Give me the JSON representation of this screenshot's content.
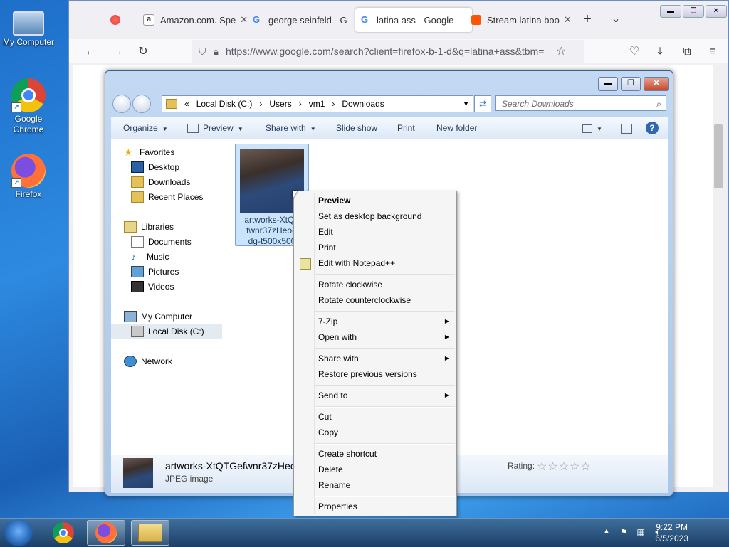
{
  "desktop": {
    "icons": [
      {
        "label": "My Computer"
      },
      {
        "label": "Google Chrome"
      },
      {
        "label": "Firefox"
      }
    ]
  },
  "firefox": {
    "tabs": [
      {
        "label": ""
      },
      {
        "label": "Amazon.com. Spe"
      },
      {
        "label": "george seinfeld - G"
      },
      {
        "label": "latina ass - Google"
      },
      {
        "label": "Stream latina boo"
      }
    ],
    "url": "https://www.google.com/search?client=firefox-b-1-d&q=latina+ass&tbm="
  },
  "explorer": {
    "breadcrumb": [
      "«",
      "Local Disk (C:)",
      "Users",
      "vm1",
      "Downloads"
    ],
    "search_placeholder": "Search Downloads",
    "toolbar": {
      "organize": "Organize",
      "preview": "Preview",
      "share_with": "Share with",
      "slide_show": "Slide show",
      "print": "Print",
      "new_folder": "New folder"
    },
    "nav": {
      "favorites": "Favorites",
      "desktop": "Desktop",
      "downloads": "Downloads",
      "recent_places": "Recent Places",
      "libraries": "Libraries",
      "documents": "Documents",
      "music": "Music",
      "pictures": "Pictures",
      "videos": "Videos",
      "my_computer": "My Computer",
      "local_disk": "Local Disk (C:)",
      "network": "Network"
    },
    "file": {
      "caption_line1": "artworks-XtQT",
      "caption_line2": "fwnr37zHeo-r",
      "caption_line3": "dg-t500x500"
    },
    "details": {
      "filename": "artworks-XtQTGefwnr37zHeo-r",
      "type": "JPEG image",
      "rating_label": "Rating:",
      "stars": "☆☆☆☆☆"
    }
  },
  "context_menu": {
    "preview": "Preview",
    "set_desktop_bg": "Set as desktop background",
    "edit": "Edit",
    "print": "Print",
    "edit_notepad": "Edit with Notepad++",
    "rotate_cw": "Rotate clockwise",
    "rotate_ccw": "Rotate counterclockwise",
    "seven_zip": "7-Zip",
    "open_with": "Open with",
    "share_with": "Share with",
    "restore": "Restore previous versions",
    "send_to": "Send to",
    "cut": "Cut",
    "copy": "Copy",
    "create_shortcut": "Create shortcut",
    "delete": "Delete",
    "rename": "Rename",
    "properties": "Properties"
  },
  "taskbar": {
    "time": "9:22 PM",
    "date": "6/5/2023"
  },
  "colors": {
    "accent": "#1e6fc9",
    "menu_bg": "#f5f5f5"
  }
}
